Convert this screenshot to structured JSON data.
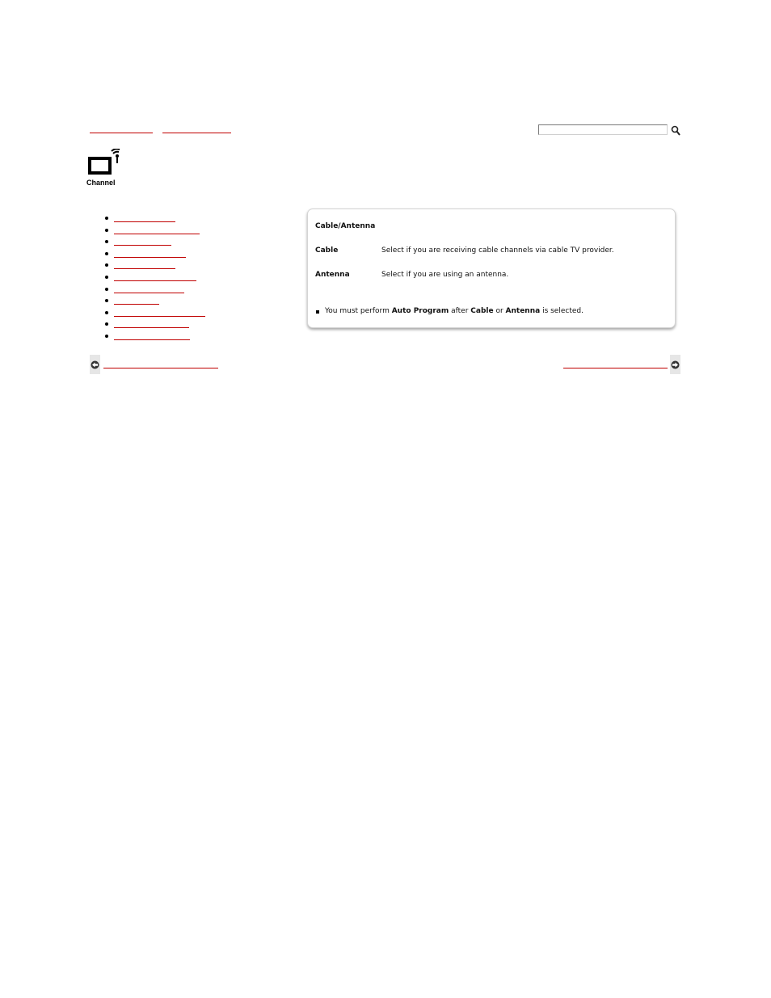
{
  "breadcrumb": {
    "links": [
      "",
      ""
    ]
  },
  "search": {
    "value": "",
    "icon": "magnifier-icon"
  },
  "section": {
    "label": "Channel",
    "icon": "tv-antenna-icon"
  },
  "sidebar": {
    "link_count": 11
  },
  "panel": {
    "title": "Cable/Antenna",
    "rows": [
      {
        "term": "Cable",
        "desc": "Select if you are receiving cable channels via cable TV provider."
      },
      {
        "term": "Antenna",
        "desc": "Select if you are using an antenna."
      }
    ],
    "note": {
      "pre": "You must perform ",
      "b1": "Auto Program",
      "mid1": " after ",
      "b2": "Cable",
      "mid2": " or ",
      "b3": "Antenna",
      "post": " is selected."
    }
  },
  "nav": {
    "prev_icon": "arrow-left-icon",
    "next_icon": "arrow-right-icon",
    "prev_label": "",
    "next_label": ""
  },
  "colors": {
    "link": "#c00000",
    "panel_border": "#d4d4d4"
  }
}
